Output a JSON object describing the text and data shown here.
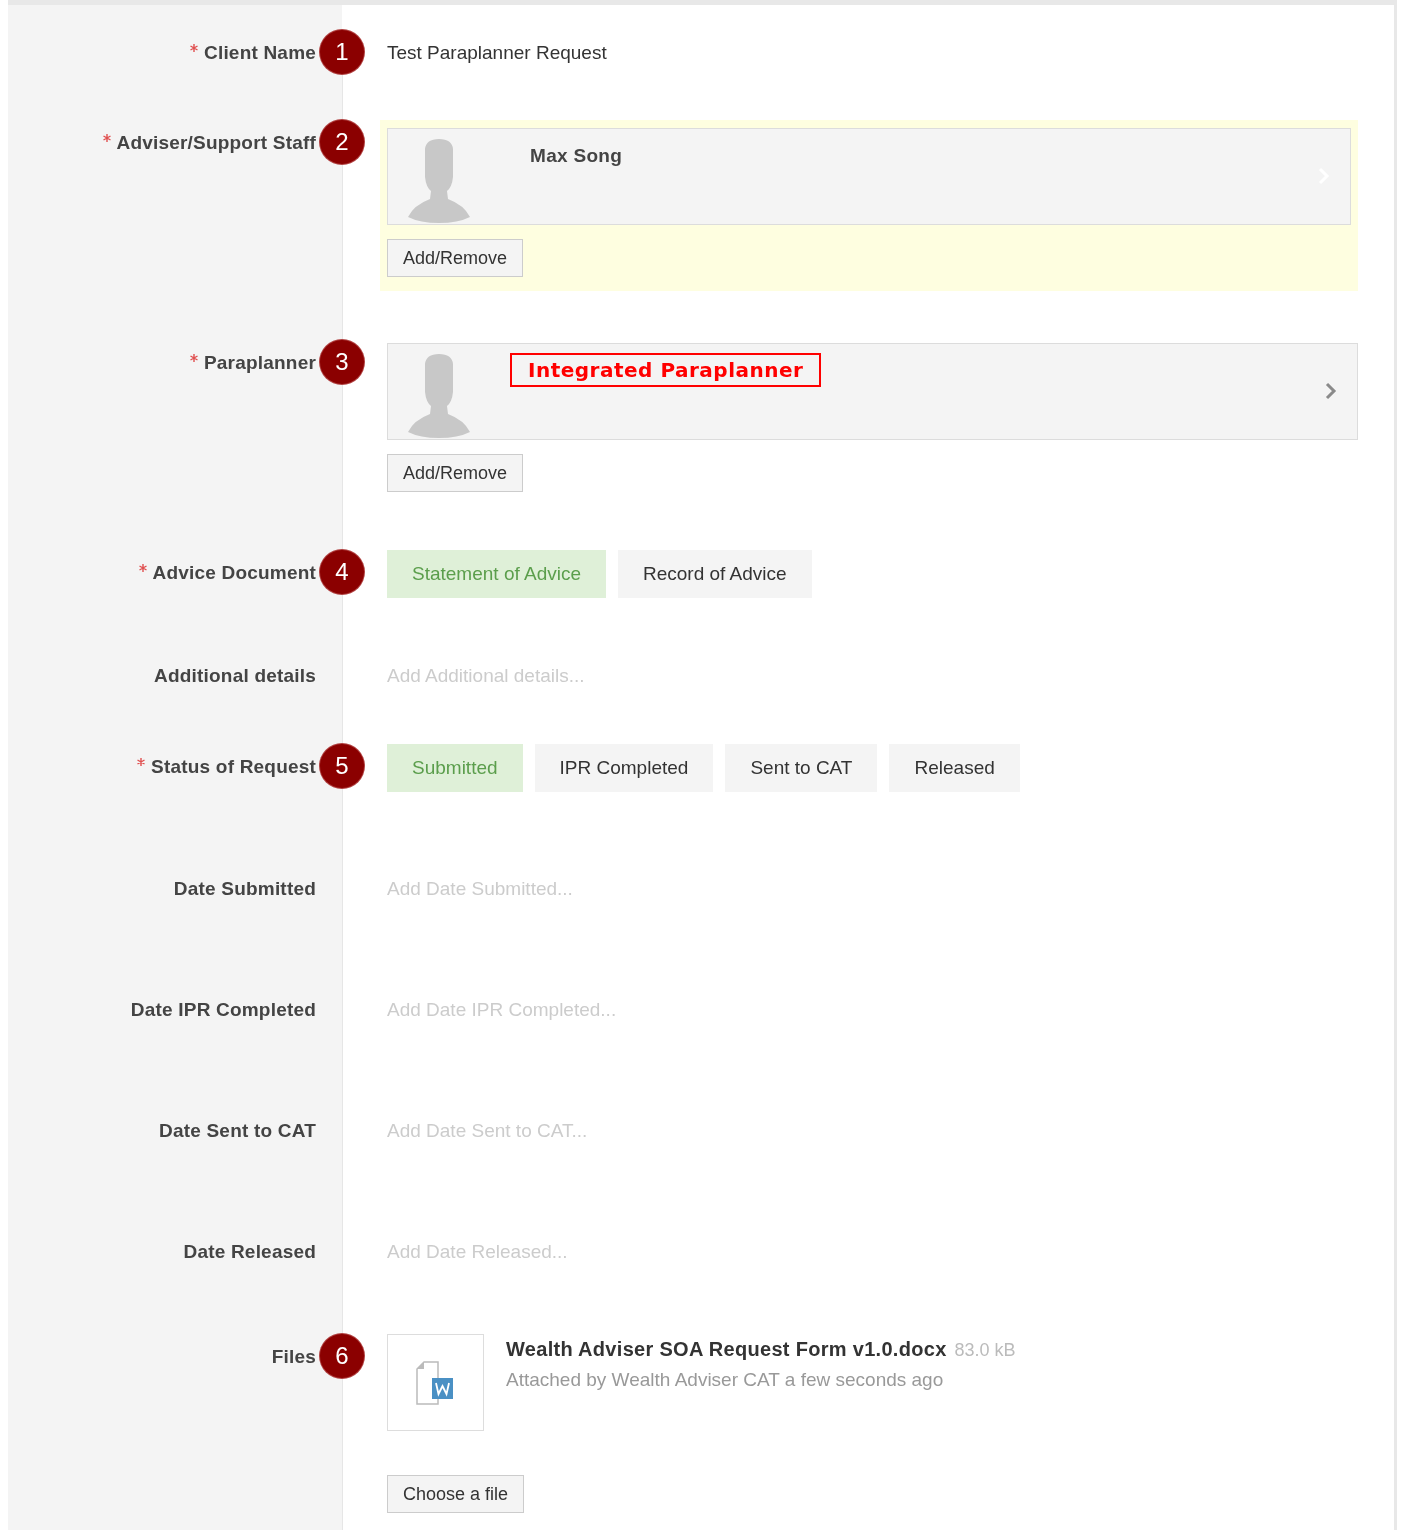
{
  "fields": [
    {
      "kind": "text",
      "label": "Client Name",
      "required": true,
      "step": "1",
      "value": "Test Paraplanner Request"
    },
    {
      "kind": "people",
      "label": "Adviser/Support Staff",
      "required": true,
      "step": "2",
      "highlighted": true,
      "person": {
        "name": "Max Song",
        "outlined": false
      },
      "button": "Add/Remove"
    },
    {
      "kind": "people",
      "label": "Paraplanner",
      "required": true,
      "step": "3",
      "highlighted": false,
      "person": {
        "name": "Integrated Paraplanner",
        "outlined": true
      },
      "button": "Add/Remove"
    },
    {
      "kind": "choice",
      "label": "Advice Document",
      "required": true,
      "step": "4",
      "options": [
        {
          "label": "Statement of Advice",
          "selected": true
        },
        {
          "label": "Record of Advice",
          "selected": false
        }
      ]
    },
    {
      "kind": "empty",
      "label": "Additional details",
      "required": false,
      "placeholder": "Add Additional details..."
    },
    {
      "kind": "choice",
      "label": "Status of Request",
      "required": true,
      "step": "5",
      "options": [
        {
          "label": "Submitted",
          "selected": true
        },
        {
          "label": "IPR Completed",
          "selected": false
        },
        {
          "label": "Sent to CAT",
          "selected": false
        },
        {
          "label": "Released",
          "selected": false
        }
      ]
    },
    {
      "kind": "empty",
      "label": "Date Submitted",
      "required": false,
      "placeholder": "Add Date Submitted..."
    },
    {
      "kind": "empty",
      "label": "Date IPR Completed",
      "required": false,
      "placeholder": "Add Date IPR Completed..."
    },
    {
      "kind": "empty",
      "label": "Date Sent to CAT",
      "required": false,
      "placeholder": "Add Date Sent to CAT..."
    },
    {
      "kind": "empty",
      "label": "Date Released",
      "required": false,
      "placeholder": "Add Date Released..."
    },
    {
      "kind": "files",
      "label": "Files",
      "required": false,
      "step": "6",
      "files": [
        {
          "name": "Wealth Adviser SOA Request Form v1.0.docx",
          "size": "83.0 kB",
          "attribution": "Attached by Wealth Adviser CAT a few seconds ago"
        }
      ],
      "button": "Choose a file"
    }
  ]
}
